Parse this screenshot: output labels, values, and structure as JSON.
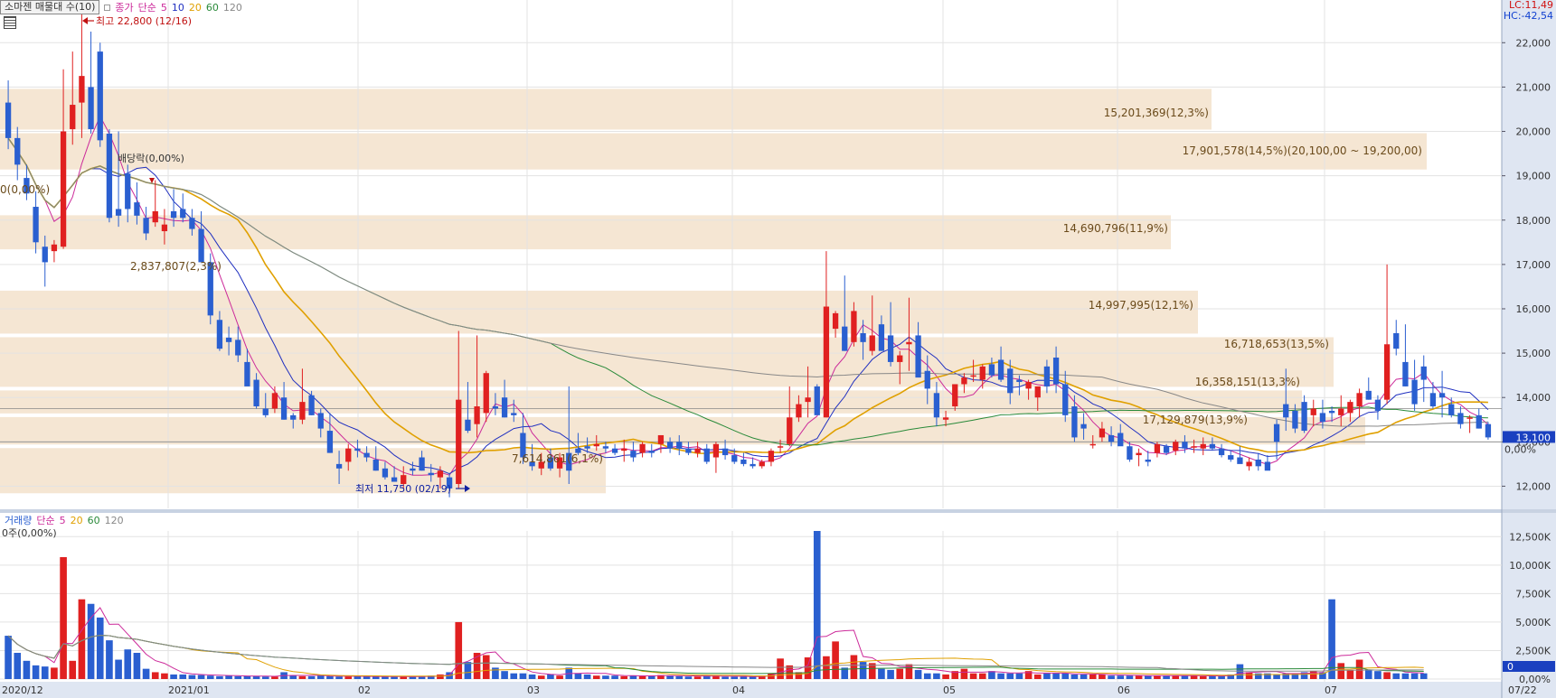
{
  "header": {
    "title": "소마젠 매물대 수(10)",
    "close_label": "종가",
    "ma_label": "단순",
    "ma_periods": [
      "5",
      "10",
      "20",
      "60",
      "120"
    ],
    "ma_colors": [
      "#cc2a9a",
      "#2030c0",
      "#e0a000",
      "#2a8a3a",
      "#888888"
    ],
    "lc_label": "LC:11,49",
    "hc_label": "HC:-42,54"
  },
  "volume_header": {
    "title": "거래량",
    "ma_label": "단순",
    "ma_periods": [
      "5",
      "20",
      "60",
      "120"
    ],
    "ma_colors": [
      "#cc2a9a",
      "#e0a000",
      "#2a8a3a",
      "#888888"
    ],
    "sub_label": "0주(0,00%)"
  },
  "colors": {
    "up": "#e02020",
    "down": "#2a5fd0",
    "profile": "#f5e6d3",
    "axis_bg": "#dfe6f2"
  },
  "chart_data": [
    {
      "type": "candlestick",
      "title": "소마젠 매물대 수(10)",
      "ylim": [
        11500,
        22800
      ],
      "y_ticks": [
        12000,
        13000,
        14000,
        15000,
        16000,
        17000,
        18000,
        19000,
        20000,
        21000,
        22000
      ],
      "y_tick_labels": [
        "12,000",
        "13,000",
        "14,000",
        "15,000",
        "16,000",
        "17,000",
        "18,000",
        "19,000",
        "20,000",
        "21,000",
        "22,000"
      ],
      "x_labels": [
        "2020/12",
        "2021/01",
        "02",
        "03",
        "04",
        "05",
        "06",
        "07",
        "07/22"
      ],
      "current_price": 13100,
      "current_price_label": "13,100",
      "zero_pct_label": "0,00%",
      "candles": [
        [
          20650,
          21150,
          19600,
          19850
        ],
        [
          19850,
          20100,
          18900,
          19250
        ],
        [
          18950,
          19250,
          18450,
          18600
        ],
        [
          18300,
          18650,
          17250,
          17500
        ],
        [
          17400,
          17650,
          16500,
          17050
        ],
        [
          17300,
          17550,
          17050,
          17450
        ],
        [
          17400,
          21400,
          17350,
          20000
        ],
        [
          20050,
          21800,
          19700,
          20600
        ],
        [
          20650,
          22800,
          19850,
          21250
        ],
        [
          21000,
          22250,
          19950,
          20050
        ],
        [
          21800,
          22000,
          19650,
          19800
        ],
        [
          19950,
          20050,
          17950,
          18050
        ],
        [
          18250,
          20000,
          17850,
          18100
        ],
        [
          19050,
          19250,
          17950,
          18250
        ],
        [
          18400,
          18850,
          17900,
          18100
        ],
        [
          18050,
          18300,
          17550,
          17700
        ],
        [
          17950,
          18900,
          17850,
          18200
        ],
        [
          17750,
          18250,
          17450,
          17900
        ],
        [
          18200,
          18700,
          17850,
          18050
        ],
        [
          18250,
          18600,
          17950,
          18050
        ],
        [
          18050,
          18250,
          17650,
          17800
        ],
        [
          17800,
          18200,
          17350,
          17050
        ],
        [
          17050,
          17250,
          15650,
          15850
        ],
        [
          15750,
          15950,
          15050,
          15100
        ],
        [
          15350,
          15600,
          14950,
          15250
        ],
        [
          15300,
          15600,
          14800,
          14950
        ],
        [
          14800,
          15100,
          14350,
          14250
        ],
        [
          14400,
          14550,
          13750,
          13800
        ],
        [
          13750,
          14100,
          13550,
          13600
        ],
        [
          13750,
          14250,
          13650,
          14100
        ],
        [
          14000,
          14350,
          13500,
          13500
        ],
        [
          13600,
          13650,
          13300,
          13500
        ],
        [
          13500,
          14650,
          13400,
          13900
        ],
        [
          14050,
          14150,
          13600,
          13600
        ],
        [
          13650,
          13750,
          13100,
          13300
        ],
        [
          13250,
          13650,
          12750,
          12750
        ],
        [
          12500,
          12800,
          12050,
          12400
        ],
        [
          12550,
          12950,
          12350,
          12850
        ],
        [
          12850,
          13050,
          12650,
          12800
        ],
        [
          12750,
          12900,
          12550,
          12650
        ],
        [
          12600,
          12900,
          12350,
          12350
        ],
        [
          12400,
          12550,
          12150,
          12200
        ],
        [
          12200,
          12450,
          12100,
          12100
        ],
        [
          12050,
          12450,
          11950,
          12250
        ],
        [
          12400,
          12550,
          12250,
          12350
        ],
        [
          12650,
          12800,
          12350,
          12350
        ],
        [
          12300,
          12500,
          12100,
          12250
        ],
        [
          12200,
          12450,
          11950,
          12350
        ],
        [
          12200,
          12300,
          11750,
          11950
        ],
        [
          12050,
          15500,
          11950,
          13950
        ],
        [
          13500,
          14350,
          13200,
          13250
        ],
        [
          13400,
          15400,
          13100,
          13800
        ],
        [
          13650,
          14600,
          13450,
          14550
        ],
        [
          13800,
          14100,
          13600,
          13750
        ],
        [
          14000,
          14400,
          13550,
          13550
        ],
        [
          13650,
          13950,
          13450,
          13600
        ],
        [
          13200,
          13650,
          12500,
          12650
        ],
        [
          12550,
          12950,
          12350,
          12450
        ],
        [
          12400,
          12750,
          12250,
          12550
        ],
        [
          12650,
          12850,
          12350,
          12400
        ],
        [
          12400,
          12750,
          12200,
          12650
        ],
        [
          12750,
          14250,
          12050,
          12350
        ],
        [
          12850,
          13200,
          12700,
          12750
        ],
        [
          12900,
          13100,
          12750,
          12850
        ],
        [
          12900,
          13150,
          12800,
          12950
        ],
        [
          12900,
          13000,
          12750,
          12850
        ],
        [
          12850,
          12950,
          12700,
          12750
        ],
        [
          12800,
          13050,
          12550,
          12850
        ],
        [
          12800,
          13000,
          12550,
          12650
        ],
        [
          12750,
          13000,
          12650,
          12950
        ],
        [
          12800,
          12950,
          12650,
          12750
        ],
        [
          12950,
          13150,
          12750,
          13150
        ],
        [
          13000,
          13100,
          12750,
          12850
        ],
        [
          13000,
          13150,
          12700,
          12850
        ],
        [
          12850,
          13000,
          12700,
          12750
        ],
        [
          12750,
          13000,
          12650,
          12850
        ],
        [
          12850,
          12950,
          12500,
          12550
        ],
        [
          12650,
          13000,
          12300,
          12950
        ],
        [
          12850,
          13050,
          12600,
          12700
        ],
        [
          12700,
          12850,
          12500,
          12550
        ],
        [
          12600,
          12750,
          12450,
          12500
        ],
        [
          12500,
          12650,
          12400,
          12450
        ],
        [
          12450,
          12600,
          12400,
          12550
        ],
        [
          12550,
          12850,
          12450,
          12800
        ],
        [
          12900,
          13050,
          12750,
          12900
        ],
        [
          12950,
          14250,
          12900,
          13550
        ],
        [
          13550,
          14050,
          13450,
          13850
        ],
        [
          13900,
          14700,
          13550,
          14000
        ],
        [
          14250,
          14300,
          13650,
          13600
        ],
        [
          13550,
          17300,
          13550,
          16050
        ],
        [
          15550,
          15950,
          15350,
          15900
        ],
        [
          15600,
          16750,
          15050,
          15050
        ],
        [
          15250,
          16150,
          15150,
          15950
        ],
        [
          15450,
          15750,
          14850,
          15250
        ],
        [
          15050,
          16300,
          14950,
          15400
        ],
        [
          15650,
          15850,
          15050,
          15050
        ],
        [
          15400,
          16150,
          14700,
          14800
        ],
        [
          14800,
          15050,
          14300,
          14950
        ],
        [
          15200,
          16250,
          14600,
          15250
        ],
        [
          15400,
          15700,
          14600,
          14450
        ],
        [
          14600,
          14950,
          13850,
          14200
        ],
        [
          14100,
          14350,
          13350,
          13550
        ],
        [
          13500,
          13700,
          13350,
          13550
        ],
        [
          13800,
          14300,
          13700,
          14300
        ],
        [
          14300,
          14550,
          14100,
          14450
        ],
        [
          14500,
          14850,
          14350,
          14500
        ],
        [
          14400,
          14750,
          14200,
          14700
        ],
        [
          14750,
          14900,
          14450,
          14500
        ],
        [
          14850,
          15150,
          14350,
          14400
        ],
        [
          14650,
          14850,
          13850,
          14100
        ],
        [
          14400,
          14500,
          14050,
          14350
        ],
        [
          14200,
          14400,
          13950,
          14350
        ],
        [
          14000,
          14200,
          13700,
          14250
        ],
        [
          14700,
          14850,
          14100,
          14250
        ],
        [
          14900,
          15150,
          14100,
          14300
        ],
        [
          14300,
          14600,
          13450,
          13600
        ],
        [
          13800,
          14050,
          13000,
          13100
        ],
        [
          13400,
          13650,
          13050,
          13300
        ],
        [
          12950,
          13150,
          12850,
          12950
        ],
        [
          13100,
          13450,
          13000,
          13300
        ],
        [
          13150,
          13350,
          12900,
          13000
        ],
        [
          13200,
          13400,
          12950,
          12900
        ],
        [
          12900,
          13000,
          12550,
          12600
        ],
        [
          12700,
          12850,
          12450,
          12750
        ],
        [
          12600,
          12800,
          12450,
          12550
        ],
        [
          12750,
          13000,
          12650,
          12950
        ],
        [
          12900,
          12950,
          12700,
          12750
        ],
        [
          12800,
          13050,
          12700,
          13000
        ],
        [
          13000,
          13150,
          12750,
          12850
        ],
        [
          12900,
          13050,
          12750,
          12900
        ],
        [
          12850,
          13100,
          12700,
          12950
        ],
        [
          12950,
          13100,
          12800,
          12850
        ],
        [
          12850,
          12950,
          12650,
          12700
        ],
        [
          12700,
          12800,
          12550,
          12600
        ],
        [
          12650,
          12900,
          12550,
          12500
        ],
        [
          12450,
          12650,
          12350,
          12550
        ],
        [
          12600,
          12750,
          12350,
          12450
        ],
        [
          12550,
          12700,
          12450,
          12350
        ],
        [
          13400,
          13500,
          12600,
          13000
        ],
        [
          13850,
          14650,
          13250,
          13550
        ],
        [
          13700,
          13850,
          13200,
          13300
        ],
        [
          13900,
          14050,
          13200,
          13250
        ],
        [
          13600,
          13950,
          13350,
          13750
        ],
        [
          13650,
          13950,
          13300,
          13450
        ],
        [
          13700,
          13800,
          13450,
          13650
        ],
        [
          13600,
          14050,
          13350,
          13750
        ],
        [
          13650,
          13950,
          13450,
          13900
        ],
        [
          13800,
          14200,
          13550,
          14100
        ],
        [
          14150,
          14450,
          13950,
          13950
        ],
        [
          13950,
          14050,
          13500,
          13700
        ],
        [
          13950,
          17000,
          13850,
          15200
        ],
        [
          15450,
          15750,
          14950,
          15100
        ],
        [
          14800,
          15650,
          14250,
          14250
        ],
        [
          14400,
          14850,
          13700,
          13850
        ],
        [
          14700,
          14950,
          13900,
          14400
        ],
        [
          14100,
          14350,
          13750,
          13800
        ],
        [
          14100,
          14600,
          13550,
          14000
        ],
        [
          13850,
          14000,
          13550,
          13600
        ],
        [
          13650,
          13800,
          13300,
          13400
        ],
        [
          13550,
          13600,
          13200,
          13550
        ],
        [
          13600,
          13750,
          13300,
          13300
        ],
        [
          13400,
          13450,
          13050,
          13100
        ]
      ],
      "volume_profile": [
        {
          "low": 11800,
          "high": 12900,
          "label": "7,614,861(6,1%)"
        },
        {
          "low": 12900,
          "high": 13600,
          "label": "17,129,879(13,9%)"
        },
        {
          "low": 13600,
          "high": 14200,
          "label": "16,358,151(13,3%)"
        },
        {
          "low": 14200,
          "high": 15400,
          "label": "16,718,653(13,5%)"
        },
        {
          "low": 15400,
          "high": 16450,
          "label": "14,997,995(12,1%)"
        },
        {
          "low": 16450,
          "high": 17300,
          "label": "0(0,00%)"
        },
        {
          "low": 17300,
          "high": 18150,
          "label": "14,690,796(11,9%)"
        },
        {
          "low": 18150,
          "high": 19100,
          "label": "2,837,807(2,3%)"
        },
        {
          "low": 19100,
          "high": 20000,
          "label": "17,901,578(14,5%)(20,100,00 ~ 19,200,00)"
        },
        {
          "low": 20000,
          "high": 21000,
          "label": "15,201,369(12,3%)"
        }
      ],
      "annotations": [
        {
          "label": "최고 22,800 (12/16)",
          "price": 22800
        },
        {
          "label": "최저 11,750 (02/19)",
          "price": 11750
        },
        {
          "label": "배당락(0,00%)"
        }
      ]
    },
    {
      "type": "bar",
      "title": "거래량",
      "ylim": [
        0,
        13000
      ],
      "y_ticks": [
        0,
        2500,
        5000,
        7500,
        10000,
        12500
      ],
      "y_tick_labels": [
        "0,00%",
        "2,500K",
        "5,000K",
        "7,500K",
        "10,000K",
        "12,500K"
      ],
      "current_volume_label": "0",
      "volume_k": [
        3800,
        2300,
        1600,
        1200,
        1100,
        1000,
        10700,
        1600,
        7000,
        6600,
        5400,
        3400,
        1700,
        2600,
        2300,
        900,
        600,
        500,
        400,
        400,
        350,
        350,
        300,
        250,
        300,
        250,
        250,
        250,
        220,
        220,
        600,
        300,
        250,
        250,
        300,
        250,
        220,
        220,
        250,
        250,
        200,
        200,
        200,
        220,
        220,
        220,
        300,
        400,
        600,
        5000,
        1500,
        2300,
        2100,
        1000,
        700,
        500,
        500,
        400,
        300,
        400,
        300,
        1000,
        500,
        400,
        300,
        300,
        300,
        250,
        300,
        250,
        300,
        350,
        300,
        250,
        220,
        220,
        300,
        300,
        200,
        200,
        200,
        220,
        300,
        500,
        1800,
        1200,
        600,
        1900,
        13000,
        2000,
        3300,
        1000,
        2100,
        1500,
        1400,
        900,
        800,
        900,
        1300,
        800,
        500,
        500,
        400,
        700,
        900,
        500,
        500,
        700,
        500,
        500,
        500,
        700,
        400,
        500,
        500,
        500,
        400,
        400,
        400,
        400,
        300,
        300,
        300,
        300,
        300,
        300,
        300,
        300,
        300,
        300,
        250,
        250,
        250,
        400,
        1300,
        600,
        500,
        500,
        400,
        500,
        500,
        600,
        700,
        600,
        7000,
        1400,
        800,
        1700,
        800,
        700,
        600,
        500,
        500,
        500,
        500
      ]
    }
  ]
}
